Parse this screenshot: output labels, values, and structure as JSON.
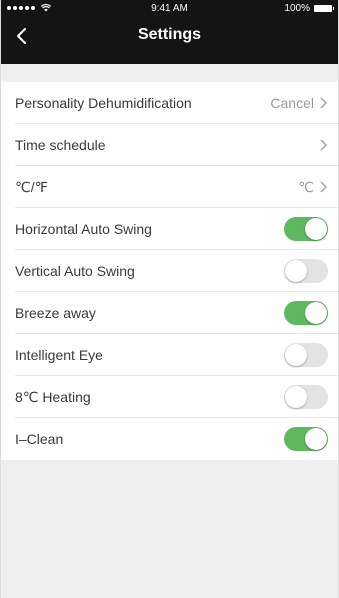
{
  "status_bar": {
    "time": "9:41 AM",
    "battery": "100%"
  },
  "nav": {
    "title": "Settings",
    "back_icon": "chevron-left-icon"
  },
  "settings": [
    {
      "label": "Personality Dehumidification",
      "type": "link",
      "value": "Cancel"
    },
    {
      "label": "Time schedule",
      "type": "link",
      "value": ""
    },
    {
      "label": "℃/℉",
      "type": "link",
      "value": "℃"
    },
    {
      "label": "Horizontal Auto Swing",
      "type": "toggle",
      "on": true
    },
    {
      "label": "Vertical Auto Swing",
      "type": "toggle",
      "on": false
    },
    {
      "label": "Breeze away",
      "type": "toggle",
      "on": true
    },
    {
      "label": "Intelligent Eye",
      "type": "toggle",
      "on": false
    },
    {
      "label": "8℃ Heating",
      "type": "toggle",
      "on": false
    },
    {
      "label": "I–Clean",
      "type": "toggle",
      "on": true
    }
  ],
  "colors": {
    "header_bg": "#141414",
    "toggle_on": "#5fb85f",
    "toggle_off": "#e3e3e3"
  }
}
